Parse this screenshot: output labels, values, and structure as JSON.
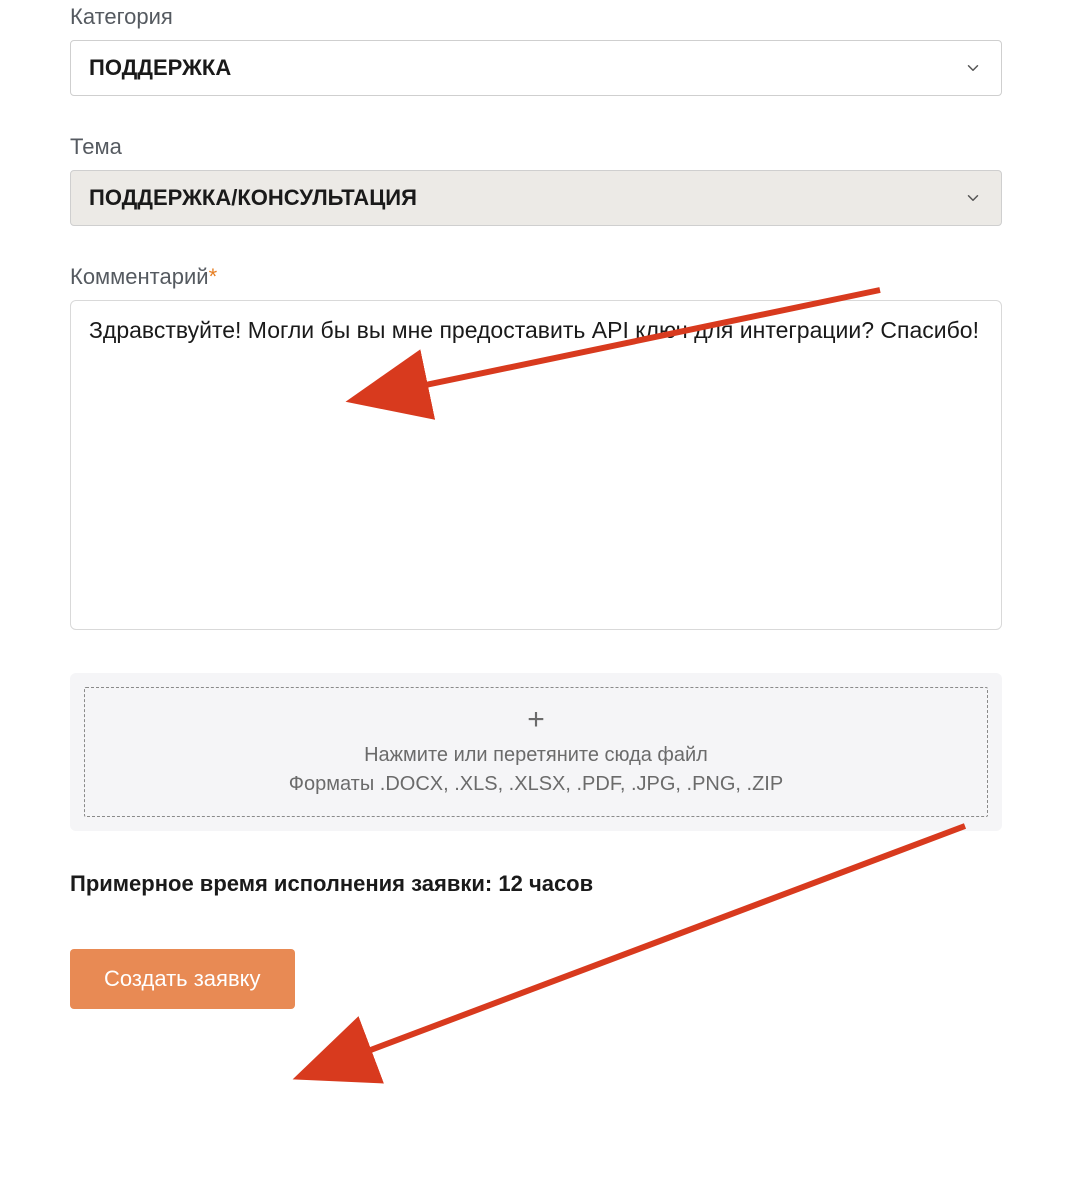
{
  "category": {
    "label": "Категория",
    "value": "ПОДДЕРЖКА"
  },
  "topic": {
    "label": "Тема",
    "value": "ПОДДЕРЖКА/КОНСУЛЬТАЦИЯ"
  },
  "comment": {
    "label": "Комментарий",
    "required_mark": "*",
    "value": "Здравствуйте! Могли бы вы мне предоставить API ключ для интеграции? Спасибо!"
  },
  "dropzone": {
    "line1": "Нажмите или перетяните сюда файл",
    "line2": "Форматы .DOCX, .XLS, .XLSX, .PDF, .JPG, .PNG, .ZIP"
  },
  "eta": {
    "prefix": "Примерное время исполнения заявки: ",
    "duration": "12 часов"
  },
  "submit_label": "Создать заявку",
  "colors": {
    "accent": "#e88a54",
    "required": "#e67e22",
    "dropzone_bg": "#f5f5f7"
  }
}
